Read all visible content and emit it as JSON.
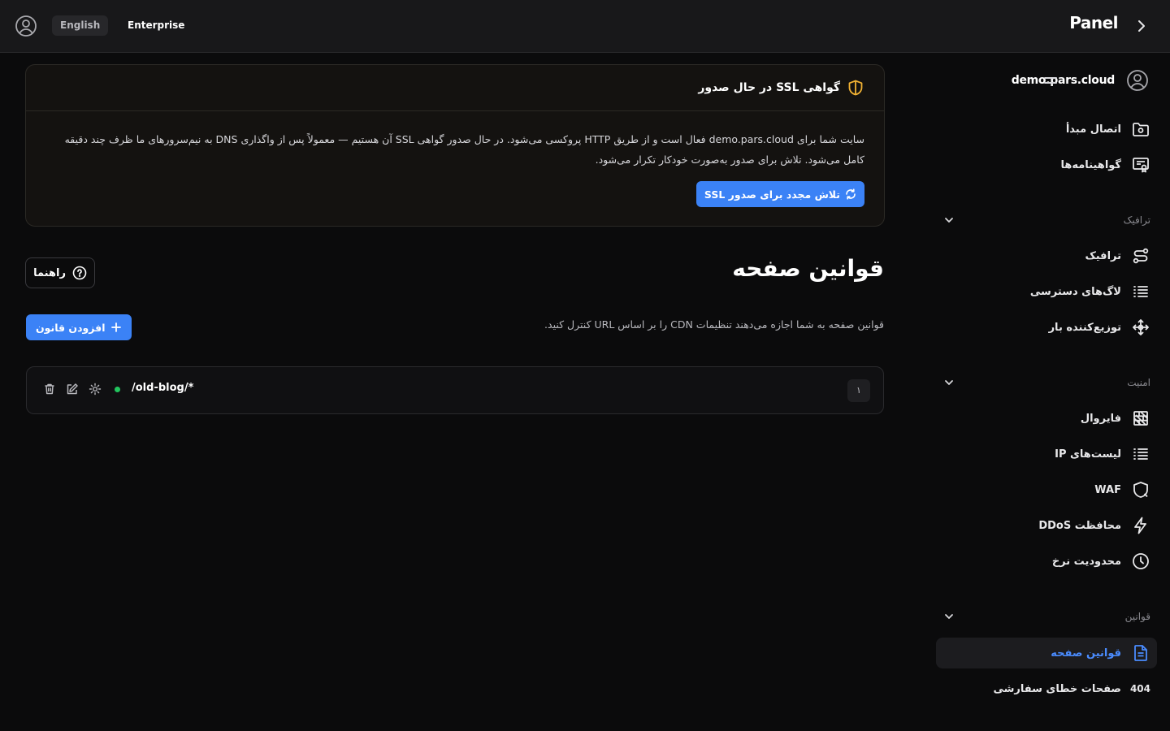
{
  "header": {
    "language": "English",
    "plan": "Enterprise",
    "app_title": "Panel"
  },
  "sidebar": {
    "site_name": "demo.pars.cloud",
    "top_items": [
      {
        "label": "اتصال مبدأ",
        "icon": "folder-link-icon"
      },
      {
        "label": "گواهینامه‌ها",
        "icon": "certificate-icon"
      }
    ],
    "sections": [
      {
        "label": "ترافیک",
        "items": [
          {
            "label": "ترافیک",
            "icon": "route-icon"
          },
          {
            "label": "لاگ‌های دسترسی",
            "icon": "list-icon"
          },
          {
            "label": "توزیع‌کننده بار",
            "icon": "load-balancer-icon"
          }
        ]
      },
      {
        "label": "امنیت",
        "items": [
          {
            "label": "فایروال",
            "icon": "firewall-icon"
          },
          {
            "label": "لیست‌های IP",
            "icon": "list-icon"
          },
          {
            "label": "WAF",
            "icon": "shield-icon"
          },
          {
            "label": "محافظت DDoS",
            "icon": "bolt-icon"
          },
          {
            "label": "محدودیت نرخ",
            "icon": "clock-icon"
          }
        ]
      },
      {
        "label": "قوانین",
        "items": [
          {
            "label": "قوانین صفحه",
            "icon": "document-icon",
            "active": true
          },
          {
            "label": "صفحات خطای سفارشی",
            "icon": "404-icon",
            "icon_text": "404"
          }
        ]
      }
    ]
  },
  "ssl_notice": {
    "title": "گواهی SSL در حال صدور",
    "line1": "سایت شما برای demo.pars.cloud فعال است و از طریق HTTP پروکسی می‌شود. در حال صدور گواهی SSL آن هستیم — معمولاً پس از واگذاری DNS به نیم‌سرورهای ما ظرف چند دقیقه",
    "line2": "کامل می‌شود. تلاش برای صدور به‌صورت خودکار تکرار می‌شود.",
    "retry_label": "تلاش مجدد برای صدور SSL"
  },
  "page": {
    "title": "قوانین صفحه",
    "help_label": "راهنما",
    "description": "قوانین صفحه به شما اجازه می‌دهند تنظیمات CDN را بر اساس URL کنترل کنید.",
    "add_label": "افزودن قانون"
  },
  "rules": [
    {
      "index": "۱",
      "path": "/old-blog/*",
      "status_color": "#22c55e"
    }
  ],
  "colors": {
    "accent": "#3b82f6",
    "warning": "#f2b233",
    "active": "#22c55e"
  }
}
